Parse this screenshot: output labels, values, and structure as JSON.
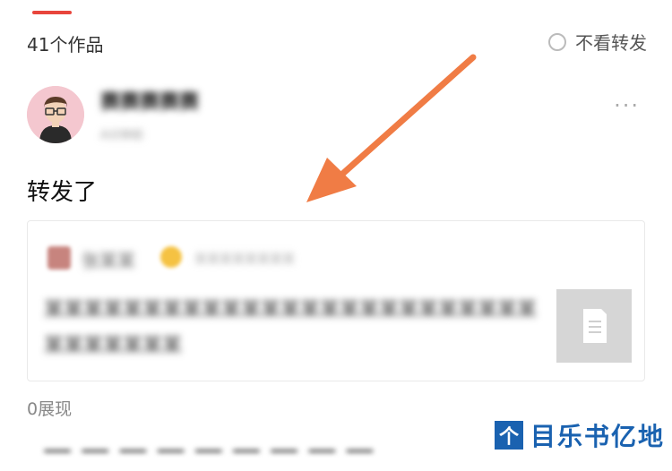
{
  "header": {
    "works_count": "41个作品",
    "hide_reposts_label": "不看转发"
  },
  "post": {
    "username": "赛赛赛赛赛",
    "user_sub": "A分钟前",
    "more_label": "···",
    "text": "转发了",
    "views": "0展现"
  },
  "quoted": {
    "author": "张某某",
    "meta": "某某某某某某某某",
    "text": "某某某某某某某某某某某某某某某某某某某某某某某某某某某某某某某某"
  },
  "bottom_blur_text": "一 一 一 一 一 一 一 一 一",
  "watermark": {
    "icon_char": "个",
    "text": "目乐书亿地"
  },
  "colors": {
    "accent": "#e8453c",
    "arrow": "#f07c45",
    "watermark": "#1a62b0"
  },
  "icons": {
    "radio": "radio-icon",
    "more": "more-icon",
    "arrow": "arrow-annotation",
    "document": "document-icon"
  }
}
